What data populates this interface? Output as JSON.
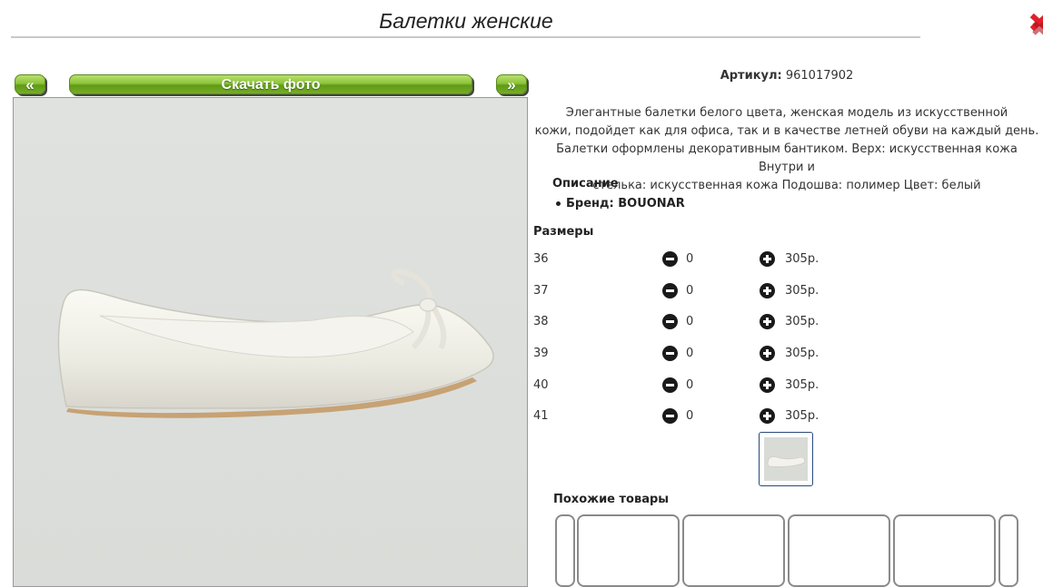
{
  "product": {
    "title": "Балетки женские",
    "article_label": "Артикул:",
    "article_value": "961017902",
    "description_lines": [
      "Элегантные балетки белого цвета, женская модель из искусственной",
      "кожи, подойдет как для офиса, так и в качестве летней обуви на каждый день.",
      "Балетки оформлены декоративным бантиком. Верх: искусственная кожа Внутри и",
      "стелька: искусственная кожа Подошва: полимер Цвет: белый"
    ],
    "description_heading": "Описание",
    "brand_line": "Бренд: BOUONAR"
  },
  "gallery": {
    "prev_label": "«",
    "download_label": "Скачать фото",
    "next_label": "»"
  },
  "sizes": {
    "heading": "Размеры",
    "rows": [
      {
        "size": "36",
        "qty": "0",
        "price": "305р."
      },
      {
        "size": "37",
        "qty": "0",
        "price": "305р."
      },
      {
        "size": "38",
        "qty": "0",
        "price": "305р."
      },
      {
        "size": "39",
        "qty": "0",
        "price": "305р."
      },
      {
        "size": "40",
        "qty": "0",
        "price": "305р."
      },
      {
        "size": "41",
        "qty": "0",
        "price": "305р."
      }
    ]
  },
  "similar": {
    "heading": "Похожие товары"
  },
  "colors": {
    "button_green": "#7fb82e",
    "close_red": "#e0202a"
  },
  "icons": {
    "close": "close-icon",
    "minus": "minus-circle-icon",
    "plus": "plus-circle-icon"
  }
}
